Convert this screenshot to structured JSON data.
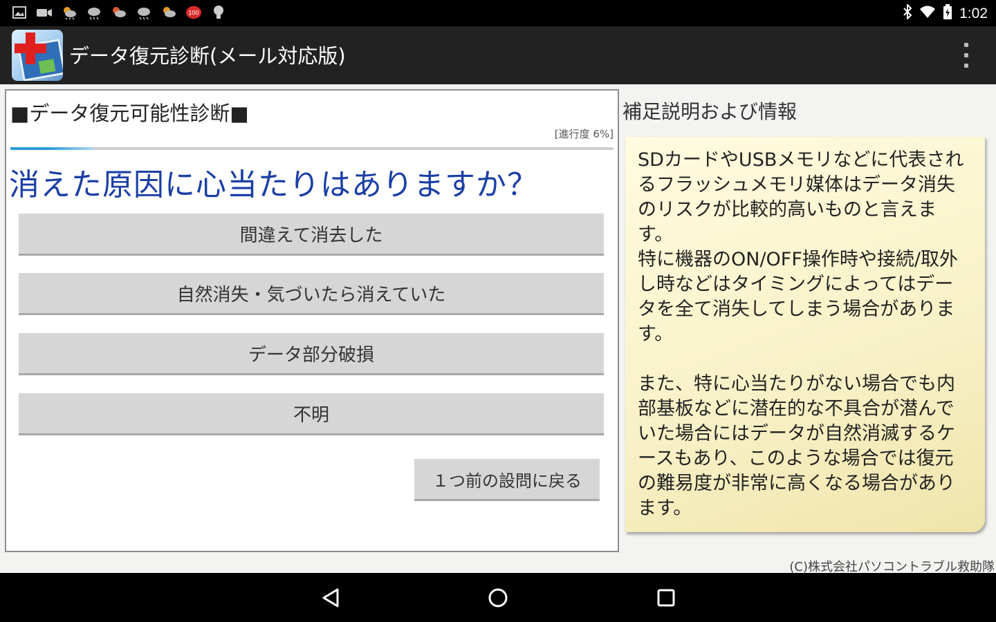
{
  "status_bar": {
    "time": "1:02",
    "notification_icons": [
      "gallery-icon",
      "video-icon",
      "weather-icon",
      "weather-icon",
      "weather-icon",
      "weather-icon",
      "weather-icon",
      "battery-100-badge-icon",
      "lightbulb-icon"
    ],
    "badge_text": "100"
  },
  "action_bar": {
    "title": "データ復元診断(メール対応版)"
  },
  "diagnosis": {
    "section_title": "■データ復元可能性診断■",
    "progress_label": "[進行度 6%]",
    "progress_value": 0.06,
    "question": "消えた原因に心当たりはありますか？",
    "answers": [
      "間違えて消去した",
      "自然消失・気づいたら消えていた",
      "データ部分破損",
      "不明"
    ],
    "back_button": "１つ前の設問に戻る"
  },
  "info": {
    "title": "補足説明および情報",
    "note": "SDカードやUSBメモリなどに代表されるフラッシュメモリ媒体はデータ消失のリスクが比較的高いものと言えます。\n特に機器のON/OFF操作時や接続/取外し時などはタイミングによってはデータを全て消失してしまう場合があります。\n\nまた、特に心当たりがない場合でも内部基板などに潜在的な不具合が潜んでいた場合にはデータが自然消滅するケースもあり、このような場合では復元の難易度が非常に高くなる場合があります。"
  },
  "footer": {
    "copyright": "(C)株式会社パソコントラブル救助隊"
  },
  "colors": {
    "question": "#1b3fa6",
    "action_bar": "#222222",
    "note": "#f8f1c6",
    "button": "#d6d6d6"
  }
}
